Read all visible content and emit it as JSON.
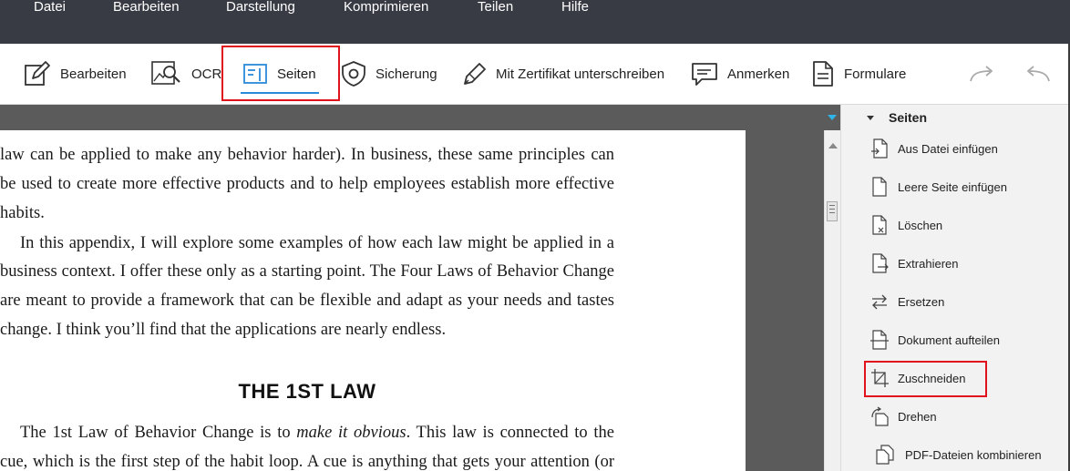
{
  "menu": [
    "Datei",
    "Bearbeiten",
    "Darstellung",
    "Komprimieren",
    "Teilen",
    "Hilfe"
  ],
  "toolbar": {
    "edit_label": "Bearbeiten",
    "ocr_label": "OCR",
    "pages_label": "Seiten",
    "protect_label": "Sicherung",
    "sign_label": "Mit Zertifikat unterschreiben",
    "comment_label": "Anmerken",
    "forms_label": "Formulare"
  },
  "document": {
    "lines": [
      "law can be applied to make any behavior harder). In business, these same principles can",
      "be used to create more effective products and to help employees establish more effective",
      "habits.",
      "In this appendix, I will explore some examples of how each law might be applied in a",
      "business context. I offer these only as a starting point. The Four Laws of Behavior Change",
      "are meant to provide a framework that can be flexible and adapt as your needs and tastes",
      "change. I think you’ll find that the applications are nearly endless."
    ],
    "heading": "THE 1ST LAW",
    "para2_line1_a": "The 1st Law of Behavior Change is to ",
    "para2_line1_em": "make it obvious",
    "para2_line1_b": ". This law is connected to the",
    "para2_line2": "cue, which is the first step of the habit loop. A cue is anything that gets your attention (or"
  },
  "panel": {
    "title": "Seiten",
    "items": [
      "Aus Datei einfügen",
      "Leere Seite einfügen",
      "Löschen",
      "Extrahieren",
      "Ersetzen",
      "Dokument aufteilen",
      "Zuschneiden",
      "Drehen",
      "PDF-Dateien kombinieren"
    ]
  },
  "colors": {
    "menubar_bg": "#383b44",
    "highlight": "#e0121b",
    "active_accent": "#2a8bd8",
    "doc_gray": "#5b5b5b",
    "panel_bg": "#f2f2f2"
  },
  "icons": [
    "edit-icon",
    "ocr-icon",
    "pages-icon",
    "shield-icon",
    "pen-icon",
    "comment-icon",
    "form-icon",
    "redo-icon",
    "undo-icon"
  ]
}
